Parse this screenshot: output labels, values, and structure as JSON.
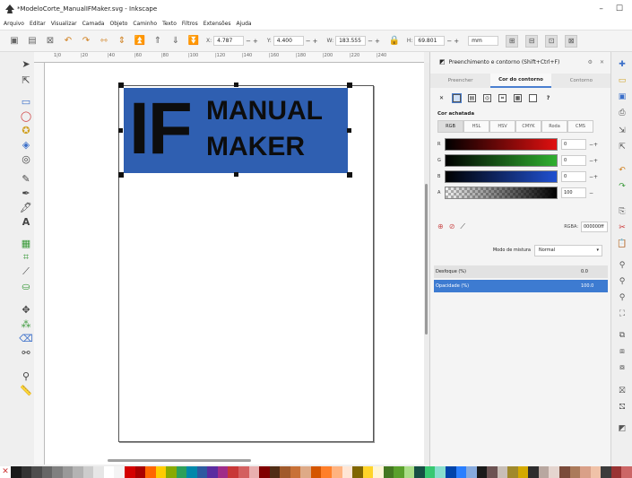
{
  "window": {
    "title": "*ModeloCorte_ManualIFMaker.svg - Inkscape"
  },
  "menu": [
    "Arquivo",
    "Editar",
    "Visualizar",
    "Camada",
    "Objeto",
    "Caminho",
    "Texto",
    "Filtros",
    "Extensões",
    "Ajuda"
  ],
  "toolbar": {
    "x_label": "X:",
    "x_value": "4.787",
    "y_label": "Y:",
    "y_value": "4.400",
    "w_label": "W:",
    "w_value": "183.555",
    "h_label": "H:",
    "h_value": "69.801",
    "unit": "mm"
  },
  "ruler_numbers": [
    "1|0",
    "|20",
    "|40",
    "|60",
    "|80",
    "|100",
    "|120",
    "|140",
    "|160",
    "|180",
    "|200",
    "|220",
    "|240"
  ],
  "artwork": {
    "big_letters": "IF",
    "line1": "MANUAL",
    "line2": "MAKER",
    "fill_color": "#2f5fb1",
    "text_color": "#0d0d0d"
  },
  "panel": {
    "title": "Preenchimento e contorno (Shift+Ctrl+F)",
    "tabs": [
      "Preencher",
      "Cor do contorno",
      "Contorno"
    ],
    "active_tab": "Cor do contorno",
    "flat_label": "Cor achatada",
    "modes": [
      "RGB",
      "HSL",
      "HSV",
      "CMYK",
      "Roda",
      "CMS"
    ],
    "active_mode": "RGB",
    "channels": [
      {
        "name": "R",
        "value": "0"
      },
      {
        "name": "G",
        "value": "0"
      },
      {
        "name": "B",
        "value": "0"
      },
      {
        "name": "A",
        "value": "100"
      }
    ],
    "rgba_label": "RGBA:",
    "rgba_value": "000000ff",
    "blend_label": "Modo de mistura",
    "blend_value": "Normal",
    "blur_label": "Desfoque (%)",
    "blur_value": "0.0",
    "opacity_label": "Opacidade (%)",
    "opacity_value": "100.0"
  },
  "palette_colors": [
    "#1a1a1a",
    "#333333",
    "#4d4d4d",
    "#666666",
    "#808080",
    "#999999",
    "#b3b3b3",
    "#cccccc",
    "#e6e6e6",
    "#ffffff",
    "#f4f4f4",
    "#d40000",
    "#aa0000",
    "#ff6600",
    "#ffcc00",
    "#88aa00",
    "#2ca05a",
    "#0088aa",
    "#2c5aa0",
    "#5a2ca0",
    "#a02c89",
    "#c83737",
    "#d35f5f",
    "#e9afaf",
    "#800000",
    "#502d16",
    "#a05a2c",
    "#c87137",
    "#deaa87",
    "#d45500",
    "#ff7f2a",
    "#ffb380",
    "#ffe6d5",
    "#806600",
    "#ffd42a",
    "#fff6d5",
    "#447821",
    "#5aa02c",
    "#aade87",
    "#165044",
    "#37c871",
    "#87decd",
    "#0044aa",
    "#2a7fff",
    "#87aade",
    "#1a1a1a",
    "#6c5353",
    "#c8beb7",
    "#a0892c",
    "#d4aa00",
    "#2d2d2d",
    "#b8a7a0",
    "#e5d5cf",
    "#7a4b3a",
    "#aa7a5a",
    "#d9a088",
    "#f0c2a8",
    "#3c3c3c",
    "#993333",
    "#cc6666"
  ]
}
